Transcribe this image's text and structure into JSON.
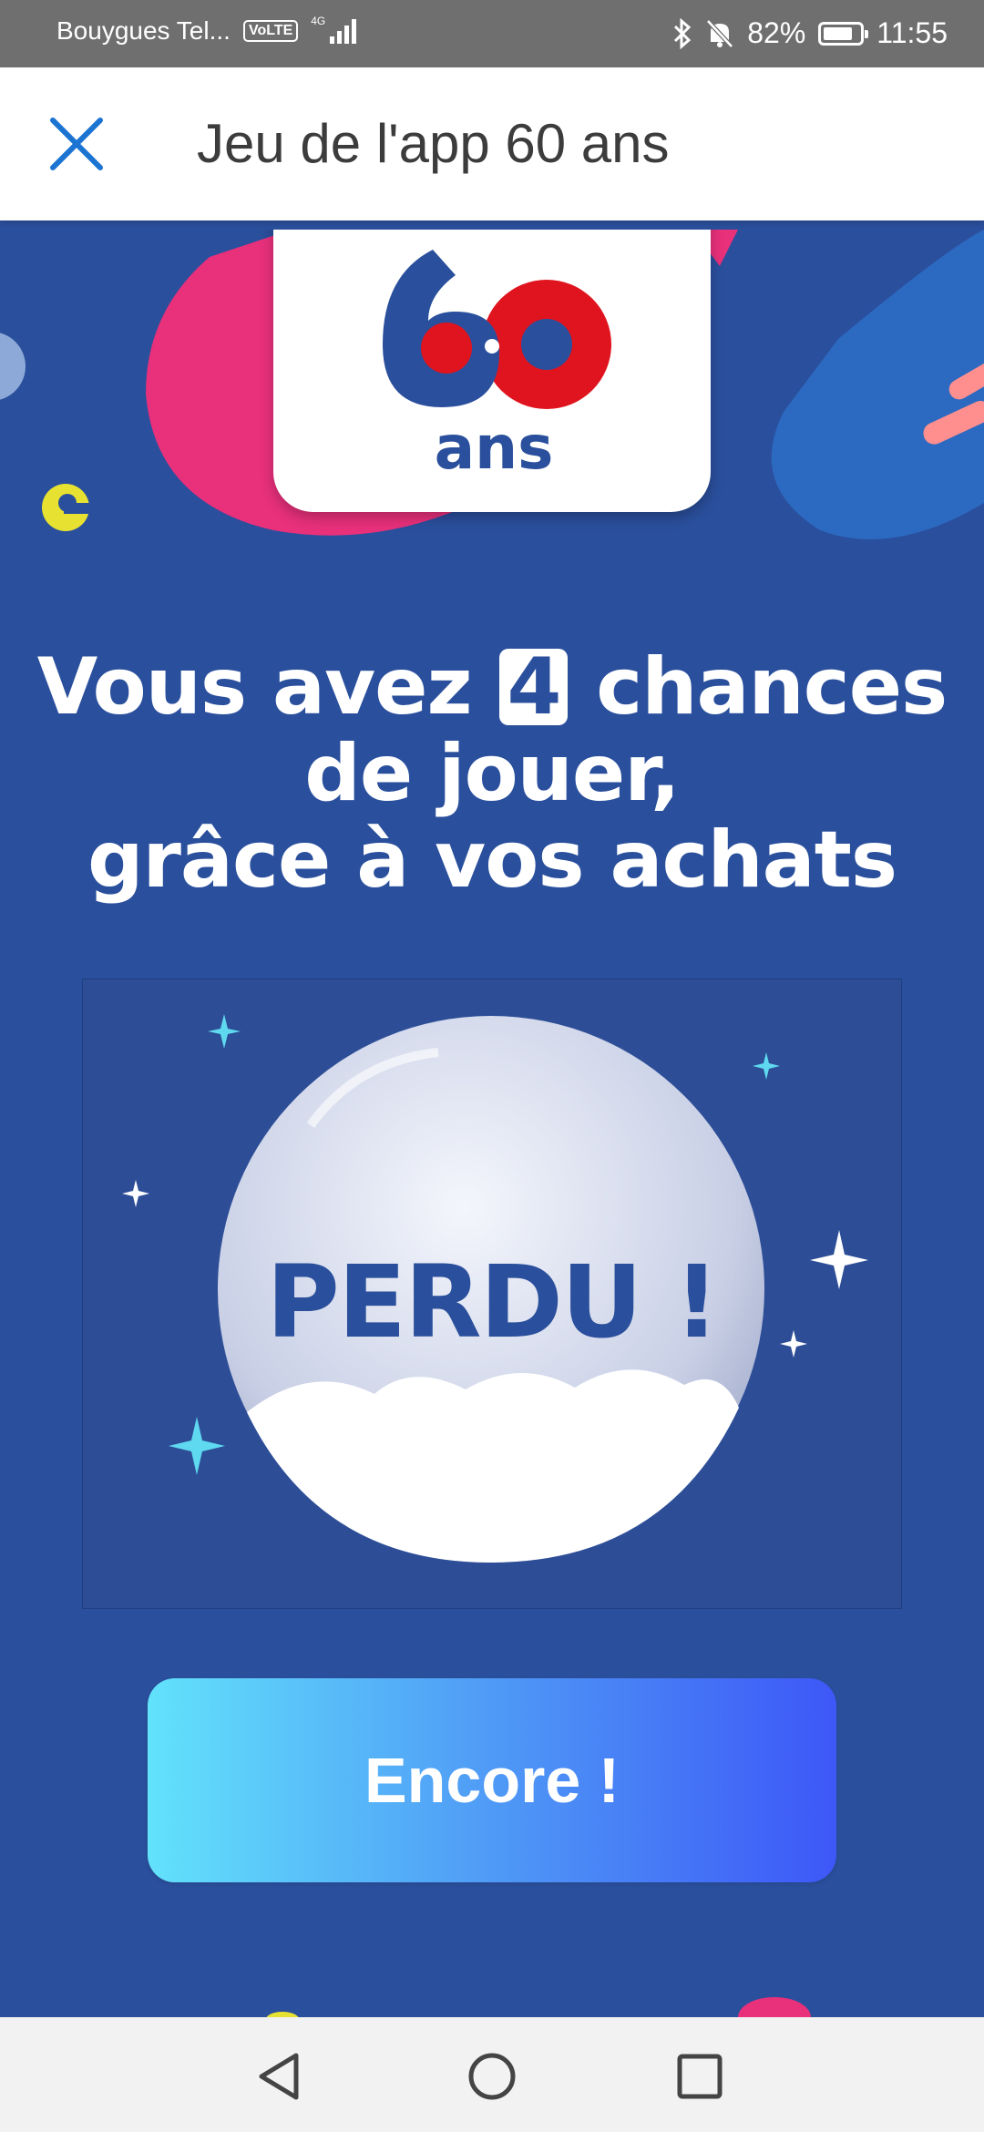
{
  "status_bar": {
    "carrier": "Bouygues Tel...",
    "volte": "VoLTE",
    "network": "4G",
    "battery": "82%",
    "battery_level": 0.82,
    "time": "11:55",
    "icons": [
      "bluetooth-icon",
      "mute-icon"
    ]
  },
  "app_bar": {
    "title": "Jeu de l'app 60 ans",
    "close_icon": "close-icon"
  },
  "logo": {
    "number": "60",
    "word": "ans",
    "colors": {
      "blue": "#2a4f9c",
      "red": "#e0141e"
    }
  },
  "headline": {
    "before": "Vous avez",
    "count": "4",
    "after": "chances de jouer,",
    "line2": "grâce à vos achats"
  },
  "result": {
    "text": "PERDU !"
  },
  "cta": {
    "label": "Encore !"
  },
  "nav_bar": {
    "icons": [
      "back-icon",
      "home-icon",
      "recents-icon"
    ]
  },
  "colors": {
    "background": "#2a4f9c",
    "cta_start": "#62e2fb",
    "cta_end": "#3d57f7",
    "accent_pink": "#f0367a"
  }
}
